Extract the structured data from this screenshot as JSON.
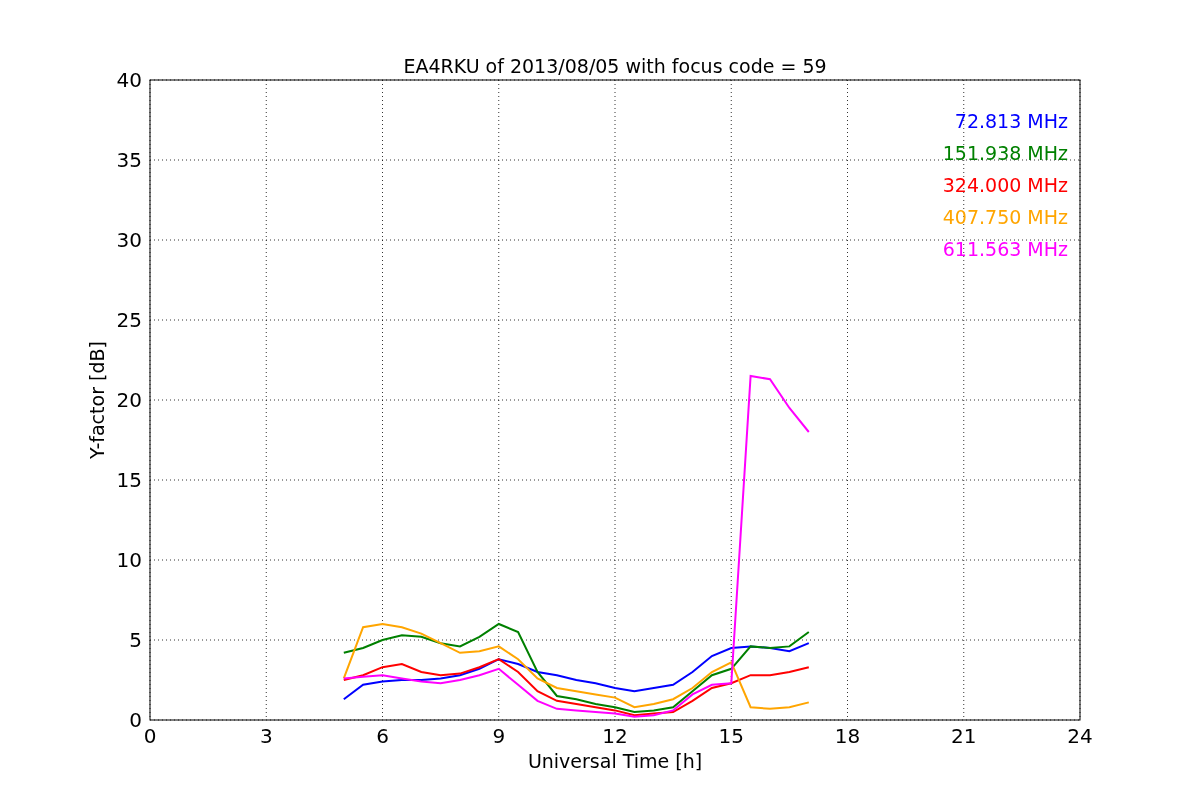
{
  "chart_data": {
    "type": "line",
    "title": "EA4RKU of 2013/08/05 with focus code = 59",
    "xlabel": "Universal Time [h]",
    "ylabel": "Y-factor [dB]",
    "x": [
      5,
      5.5,
      6,
      6.5,
      7,
      7.5,
      8,
      8.5,
      9,
      9.5,
      10,
      10.5,
      11,
      11.5,
      12,
      12.5,
      13,
      13.5,
      14,
      14.5,
      15,
      15.5,
      16,
      16.5,
      17
    ],
    "series": [
      {
        "name": "72.813 MHz",
        "color": "#0000ff",
        "values": [
          1.3,
          2.2,
          2.4,
          2.5,
          2.5,
          2.6,
          2.8,
          3.2,
          3.8,
          3.5,
          3.0,
          2.8,
          2.5,
          2.3,
          2.0,
          1.8,
          2.0,
          2.2,
          3.0,
          4.0,
          4.5,
          4.6,
          4.5,
          4.3,
          4.8
        ]
      },
      {
        "name": "151.938 MHz",
        "color": "#008000",
        "values": [
          4.2,
          4.5,
          5.0,
          5.3,
          5.2,
          4.8,
          4.6,
          5.2,
          6.0,
          5.5,
          3.0,
          1.5,
          1.3,
          1.0,
          0.8,
          0.5,
          0.6,
          0.8,
          1.8,
          2.8,
          3.2,
          4.6,
          4.5,
          4.6,
          5.5
        ]
      },
      {
        "name": "324.000 MHz",
        "color": "#ff0000",
        "values": [
          2.5,
          2.8,
          3.3,
          3.5,
          3.0,
          2.8,
          2.9,
          3.3,
          3.8,
          3.0,
          1.8,
          1.2,
          1.0,
          0.8,
          0.6,
          0.3,
          0.4,
          0.5,
          1.2,
          2.0,
          2.3,
          2.8,
          2.8,
          3.0,
          3.3
        ]
      },
      {
        "name": "407.750 MHz",
        "color": "#ffa500",
        "values": [
          2.6,
          5.8,
          6.0,
          5.8,
          5.4,
          4.8,
          4.2,
          4.3,
          4.6,
          3.8,
          2.6,
          2.0,
          1.8,
          1.6,
          1.4,
          0.8,
          1.0,
          1.3,
          2.0,
          3.0,
          3.6,
          0.8,
          0.7,
          0.8,
          1.1
        ]
      },
      {
        "name": "611.563 MHz",
        "color": "#ff00ff",
        "values": [
          2.6,
          2.7,
          2.8,
          2.6,
          2.4,
          2.3,
          2.5,
          2.8,
          3.2,
          2.2,
          1.2,
          0.7,
          0.6,
          0.5,
          0.4,
          0.2,
          0.3,
          0.6,
          1.6,
          2.2,
          2.3,
          21.5,
          21.3,
          19.5,
          18.0
        ]
      }
    ],
    "xlim": [
      0,
      24
    ],
    "ylim": [
      0,
      40
    ],
    "xticks": [
      0,
      3,
      6,
      9,
      12,
      15,
      18,
      21,
      24
    ],
    "yticks": [
      0,
      5,
      10,
      15,
      20,
      25,
      30,
      35,
      40
    ],
    "grid": true
  }
}
